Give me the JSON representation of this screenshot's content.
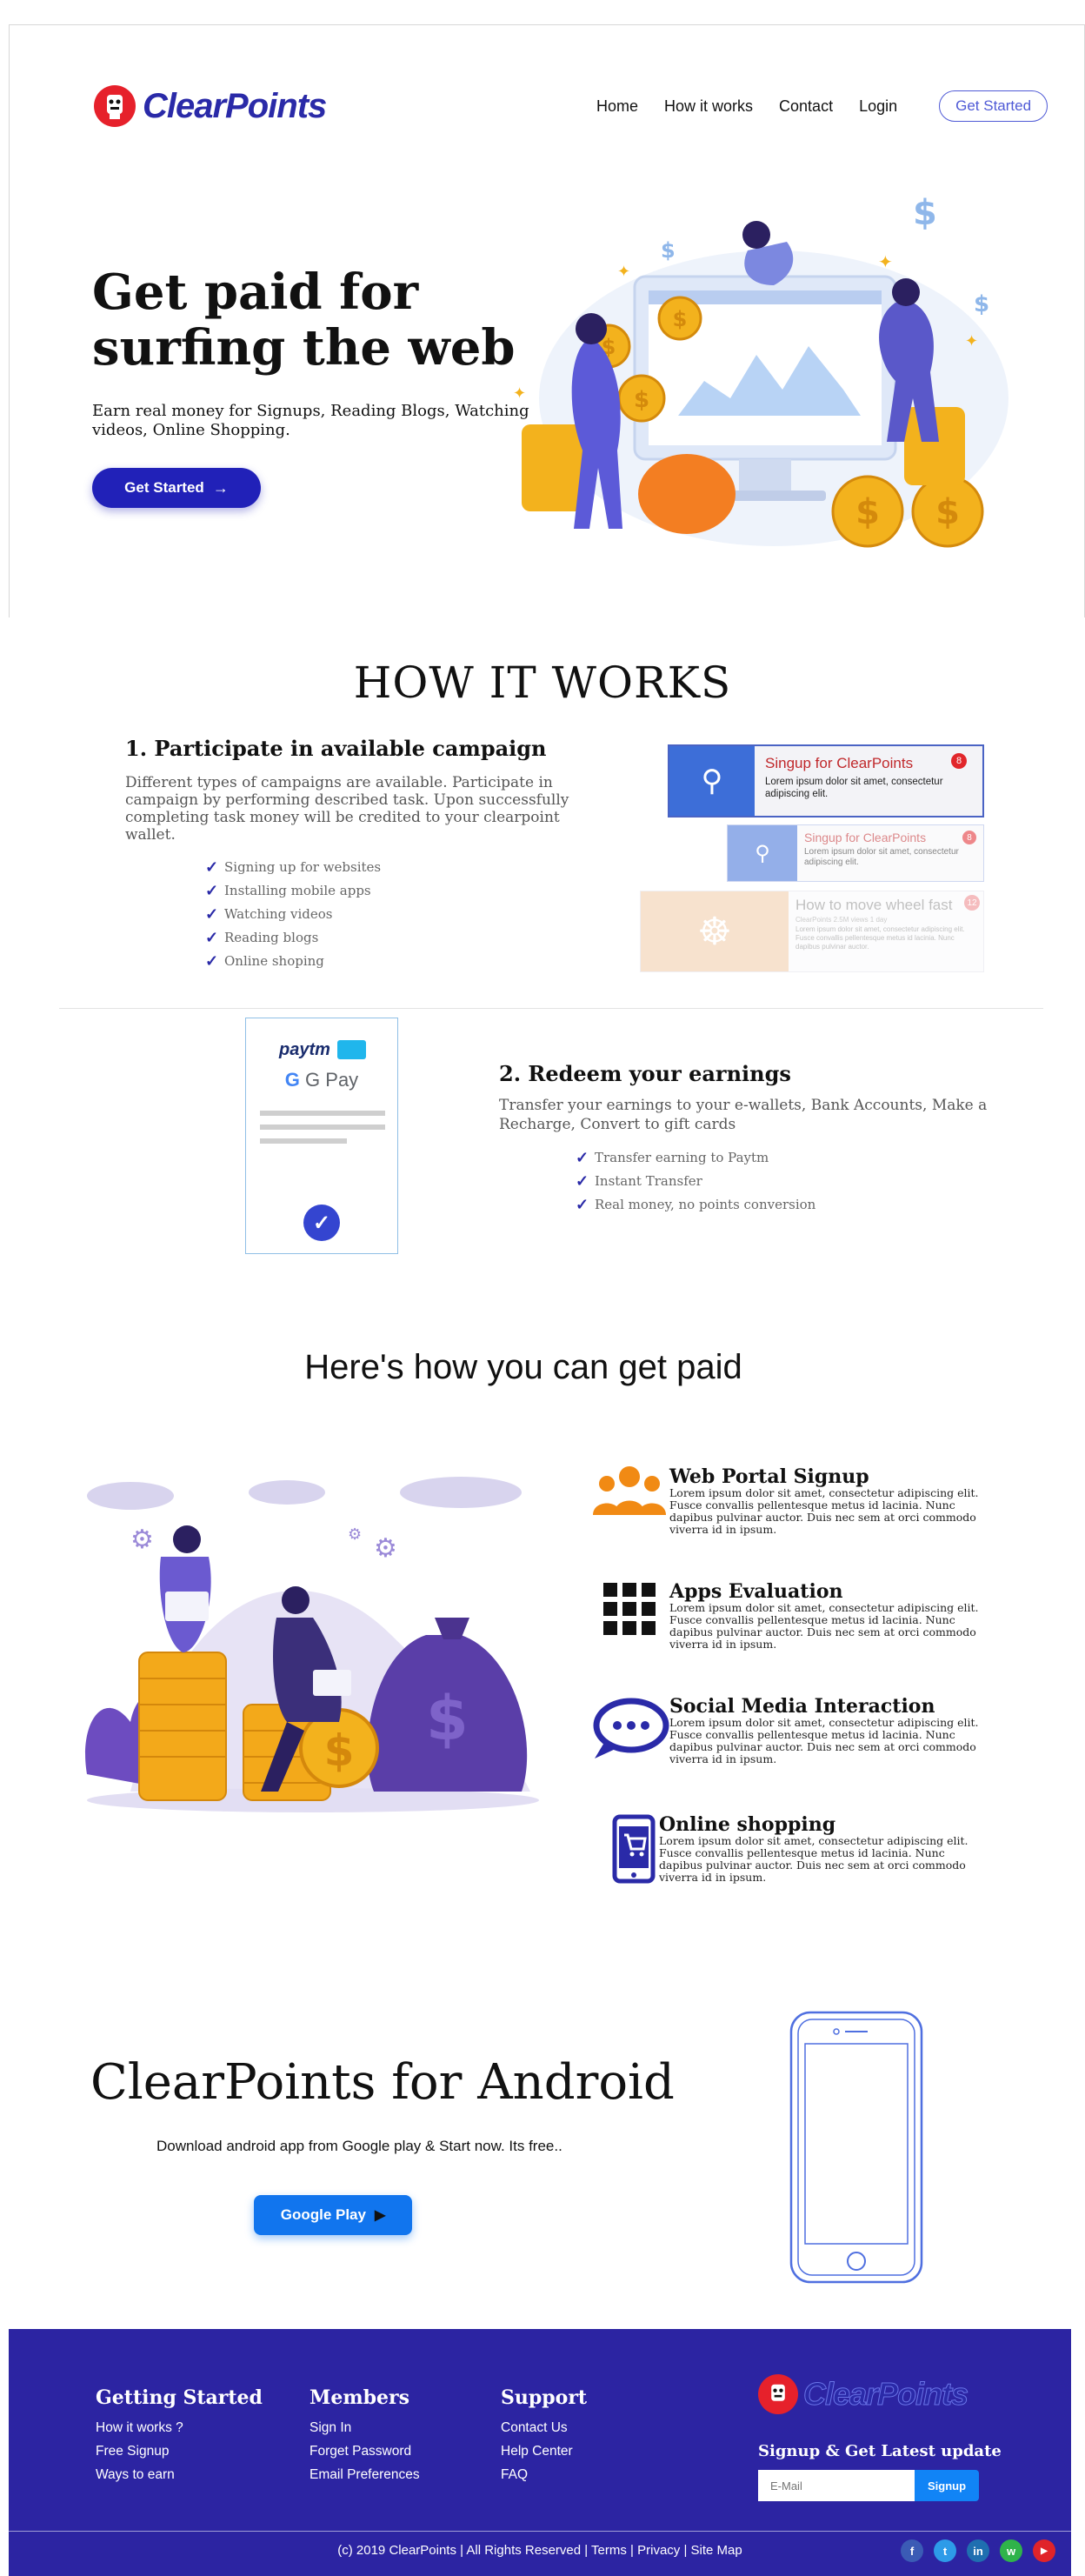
{
  "brand": {
    "name": "ClearPoints",
    "colors": {
      "primary": "#2121b8",
      "accent": "#1175ee",
      "logo_red": "#e6212b",
      "footer_bg": "#2c24a2"
    }
  },
  "nav": {
    "items": [
      "Home",
      "How it works",
      "Contact",
      "Login"
    ],
    "cta": "Get Started"
  },
  "hero": {
    "title": "Get paid for surfing the web",
    "subtitle": "Earn real money for Signups, Reading Blogs, Watching videos, Online Shopping.",
    "button": "Get Started",
    "button_icon": "arrow-right-icon"
  },
  "how_it_works": {
    "title": "HOW IT WORKS",
    "step1": {
      "title": "1. Participate in available campaign",
      "description": "Different types of campaigns are available. Participate in campaign by performing described task. Upon successfully completing task money will be credited to your clearpoint wallet.",
      "items": [
        "Signing up for websites",
        "Installing mobile apps",
        "Watching videos",
        "Reading blogs",
        "Online shoping"
      ]
    },
    "campaign_cards": [
      {
        "title": "Singup for ClearPoints",
        "text": "Lorem ipsum dolor sit amet, consectetur adipiscing elit.",
        "badge": "8"
      },
      {
        "title": "Singup for ClearPoints",
        "text": "Lorem ipsum dolor sit amet, consectetur adipiscing elit.",
        "badge": "8"
      },
      {
        "title": "How to move wheel fast",
        "text": "Lorem ipsum dolor sit amet, consectetur adipiscing elit. Fusce convallis pellentesque metus id lacinia. Nunc dapibus pulvinar auctor.",
        "badge": "12",
        "meta": "ClearPoints     2.5M views     1 day"
      }
    ],
    "step2": {
      "title": "2. Redeem your earnings",
      "description": "Transfer your earnings to your e-wallets, Bank Accounts, Make a Recharge, Convert to gift cards",
      "items": [
        "Transfer earning to Paytm",
        "Instant Transfer",
        "Real money, no points conversion"
      ],
      "wallets": [
        "paytm",
        "G Pay"
      ]
    }
  },
  "get_paid": {
    "title": "Here's how you can get paid",
    "features": [
      {
        "title": "Web Portal Signup",
        "icon": "users-icon",
        "text": "Lorem ipsum dolor sit amet, consectetur adipiscing elit. Fusce convallis pellentesque metus id lacinia. Nunc dapibus pulvinar auctor. Duis nec sem at orci commodo viverra id in ipsum."
      },
      {
        "title": "Apps Evaluation",
        "icon": "grid-icon",
        "text": "Lorem ipsum dolor sit amet, consectetur adipiscing elit. Fusce convallis pellentesque metus id lacinia. Nunc dapibus pulvinar auctor. Duis nec sem at orci commodo viverra id in ipsum."
      },
      {
        "title": "Social Media Interaction",
        "icon": "chat-bubble-icon",
        "text": "Lorem ipsum dolor sit amet, consectetur adipiscing elit. Fusce convallis pellentesque metus id lacinia. Nunc dapibus pulvinar auctor. Duis nec sem at orci commodo viverra id in ipsum."
      },
      {
        "title": "Online shopping",
        "icon": "mobile-cart-icon",
        "text": "Lorem ipsum dolor sit amet, consectetur adipiscing elit. Fusce convallis pellentesque metus id lacinia. Nunc dapibus pulvinar auctor. Duis nec sem at orci commodo viverra id in ipsum."
      }
    ]
  },
  "android": {
    "title": "ClearPoints for Android",
    "subtitle": "Download android app from Google play & Start now. Its free..",
    "button": "Google Play",
    "button_icon": "play-icon"
  },
  "footer": {
    "columns": [
      {
        "title": "Getting Started",
        "links": [
          "How it works ?",
          "Free Signup",
          "Ways to earn"
        ]
      },
      {
        "title": "Members",
        "links": [
          "Sign In",
          "Forget Password",
          "Email Preferences"
        ]
      },
      {
        "title": "Support",
        "links": [
          "Contact Us",
          "Help Center",
          "FAQ"
        ]
      }
    ],
    "newsletter": {
      "title": "Signup & Get Latest update",
      "placeholder": "E-Mail",
      "button": "Signup"
    },
    "copyright": "(c) 2019 ClearPoints | All Rights Reserved | Terms | Privacy | Site Map",
    "social": [
      {
        "icon": "facebook-icon",
        "glyph": "f",
        "color": "#3b5bb5"
      },
      {
        "icon": "twitter-icon",
        "glyph": "t",
        "color": "#2d9be8"
      },
      {
        "icon": "linkedin-icon",
        "glyph": "in",
        "color": "#1f6fb0"
      },
      {
        "icon": "whatsapp-icon",
        "glyph": "w",
        "color": "#2fb34a"
      },
      {
        "icon": "youtube-icon",
        "glyph": "▶",
        "color": "#e0242a"
      }
    ]
  }
}
